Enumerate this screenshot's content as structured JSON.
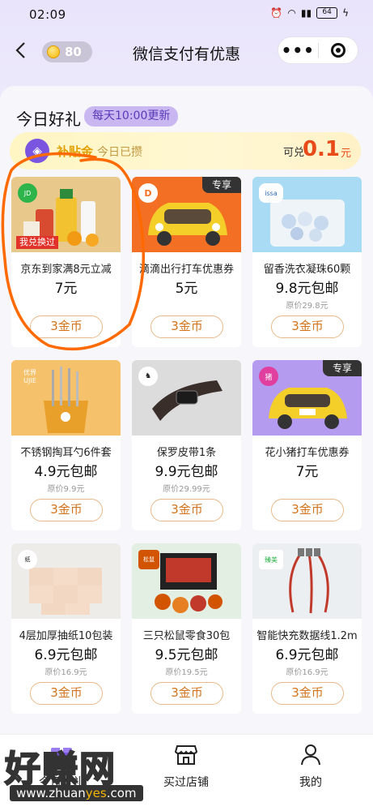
{
  "status": {
    "time": "02:09",
    "battery": "64"
  },
  "header": {
    "back_icon": "chevron-left-icon",
    "coins": "80",
    "title": "微信支付有优惠",
    "more_label": "•••"
  },
  "section": {
    "title": "今日好礼",
    "update_badge": "每天10:00更新"
  },
  "banner": {
    "label": "补贴金",
    "sub": "今日已攒",
    "redeem_label": "可兑",
    "value": "0.1",
    "unit": "元"
  },
  "products": [
    {
      "name": "京东到家满8元立减",
      "price": "7元",
      "original": "",
      "button": "3金币",
      "badge": "我兑换过",
      "tag": ""
    },
    {
      "name": "滴滴出行打车优惠券",
      "price": "5元",
      "original": "",
      "button": "3金币",
      "badge": "",
      "tag": "专享"
    },
    {
      "name": "留香洗衣凝珠60颗",
      "price": "9.8元包邮",
      "original": "原价29.8元",
      "button": "3金币",
      "badge": "",
      "tag": "",
      "logo": "issa"
    },
    {
      "name": "不锈钢掏耳勺6件套",
      "price": "4.9元包邮",
      "original": "原价9.9元",
      "button": "3金币",
      "badge": "",
      "tag": "",
      "logo": "优界 UJIE"
    },
    {
      "name": "保罗皮带1条",
      "price": "9.9元包邮",
      "original": "原价29.99元",
      "button": "3金币",
      "badge": "",
      "tag": ""
    },
    {
      "name": "花小猪打车优惠券",
      "price": "7元",
      "original": "",
      "button": "3金币",
      "badge": "",
      "tag": "专享"
    },
    {
      "name": "4层加厚抽纸10包装",
      "price": "6.9元包邮",
      "original": "原价16.9元",
      "button": "3金币",
      "badge": "",
      "tag": ""
    },
    {
      "name": "三只松鼠零食30包",
      "price": "9.5元包邮",
      "original": "原价19.5元",
      "button": "3金币",
      "badge": "",
      "tag": ""
    },
    {
      "name": "智能快充数据线1.2m",
      "price": "6.9元包邮",
      "original": "原价16.9元",
      "button": "3金币",
      "badge": "",
      "tag": ""
    }
  ],
  "tabs": [
    {
      "label": "今日好礼",
      "icon": "gift-icon"
    },
    {
      "label": "买过店铺",
      "icon": "store-icon"
    },
    {
      "label": "我的",
      "icon": "person-icon"
    }
  ],
  "watermark": {
    "main": "好赚网",
    "url_prefix": "www.zhuan",
    "url_highlight": "yes",
    "url_suffix": ".com"
  },
  "colors": {
    "accent": "#7a55e0",
    "price_red": "#e84a1a",
    "button_orange": "#d2741d",
    "annotation": "#ff6a00"
  }
}
